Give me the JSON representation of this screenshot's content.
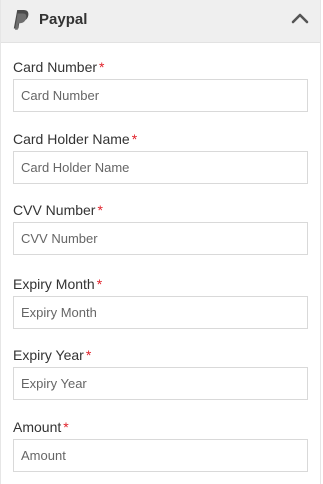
{
  "header": {
    "title": "Paypal",
    "logo_icon": "paypal-logo-icon",
    "toggle_icon": "chevron-up-icon",
    "background": "#efefef"
  },
  "form": {
    "required_marker": "*",
    "required_color": "#e0212a",
    "fields": [
      {
        "label": "Card Number",
        "placeholder": "Card Number",
        "value": ""
      },
      {
        "label": "Card Holder Name",
        "placeholder": "Card Holder Name",
        "value": ""
      },
      {
        "label": "CVV Number",
        "placeholder": "CVV Number",
        "value": ""
      },
      {
        "label": "Expiry Month",
        "placeholder": "Expiry Month",
        "value": ""
      },
      {
        "label": "Expiry Year",
        "placeholder": "Expiry Year",
        "value": ""
      },
      {
        "label": "Amount",
        "placeholder": "Amount",
        "value": ""
      }
    ]
  }
}
